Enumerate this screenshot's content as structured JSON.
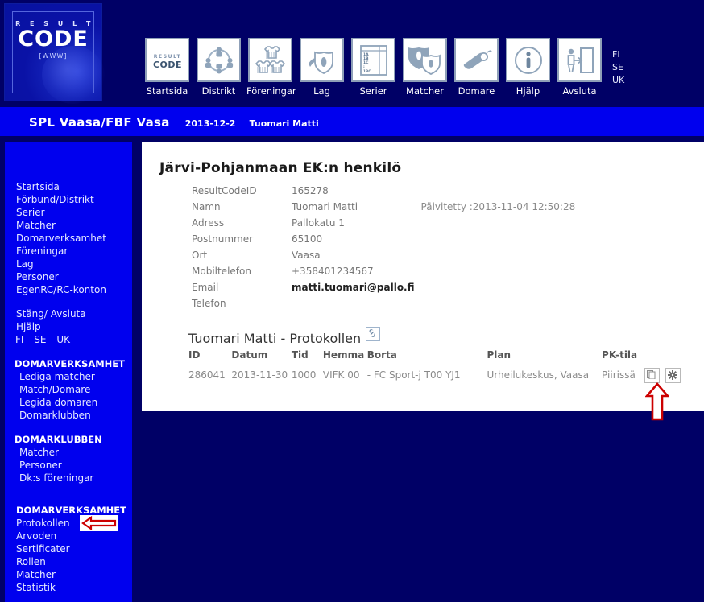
{
  "brand": {
    "logo_result": "R E S U L T",
    "logo_code": "CODE",
    "logo_www": "[WWW]"
  },
  "topnav": {
    "items": [
      {
        "label": "Startsida",
        "icon": "resultcode-logo-icon"
      },
      {
        "label": "Distrikt",
        "icon": "district-network-icon"
      },
      {
        "label": "Föreningar",
        "icon": "clubs-jerseys-icon"
      },
      {
        "label": "Lag",
        "icon": "team-flag-shield-icon"
      },
      {
        "label": "Serier",
        "icon": "series-table-icon"
      },
      {
        "label": "Matcher",
        "icon": "match-shields-icon"
      },
      {
        "label": "Domare",
        "icon": "referee-whistle-icon"
      },
      {
        "label": "Hjälp",
        "icon": "info-circle-icon"
      },
      {
        "label": "Avsluta",
        "icon": "exit-door-icon"
      }
    ],
    "languages": [
      "FI",
      "SE",
      "UK"
    ]
  },
  "subheader": {
    "org": "SPL Vaasa/FBF Vasa",
    "date": "2013-12-2",
    "user": "Tuomari Matti"
  },
  "sidebar": {
    "main_links": [
      "Startsida",
      "Förbund/Distrikt",
      "Serier",
      "Matcher",
      "Domarverksamhet",
      "Föreningar",
      "Lag",
      "Personer",
      "EgenRC/RC-konton"
    ],
    "session_links": [
      "Stäng/ Avsluta",
      "Hjälp"
    ],
    "languages": [
      "FI",
      "SE",
      "UK"
    ],
    "groups": [
      {
        "heading": "DOMARVERKSAMHET",
        "items": [
          "Lediga matcher",
          "Match/Domare",
          "Legida domaren",
          "Domarklubben"
        ]
      },
      {
        "heading": "DOMARKLUBBEN",
        "items": [
          "Matcher",
          "Personer",
          "Dk:s föreningar"
        ]
      },
      {
        "heading": "DOMARVERKSAMHET",
        "items": [
          "Protokollen",
          "Arvoden",
          "Sertificater",
          "Rollen",
          "Matcher",
          "Statistik"
        ]
      }
    ]
  },
  "page": {
    "title": "Järvi-Pohjanmaan EK:n henkilö"
  },
  "details": {
    "rows": [
      {
        "label": "ResultCodeID",
        "value": "165278",
        "extra": "",
        "bold": false
      },
      {
        "label": "Namn",
        "value": "Tuomari Matti",
        "extra": "Päivitetty :2013-11-04 12:50:28",
        "bold": false
      },
      {
        "label": "Adress",
        "value": "Pallokatu 1",
        "extra": "",
        "bold": false
      },
      {
        "label": "Postnummer",
        "value": "65100",
        "extra": "",
        "bold": false
      },
      {
        "label": "Ort",
        "value": "Vaasa",
        "extra": "",
        "bold": false
      },
      {
        "label": "Mobiltelefon",
        "value": "+358401234567",
        "extra": "",
        "bold": false
      },
      {
        "label": "Email",
        "value": "matti.tuomari@pallo.fi",
        "extra": "",
        "bold": true
      },
      {
        "label": "Telefon",
        "value": "",
        "extra": "",
        "bold": false
      }
    ]
  },
  "protocols": {
    "title": "Tuomari Matti - Protokollen",
    "link_icon": "chain-link-icon",
    "columns": [
      "ID",
      "Datum",
      "Tid",
      "Hemma",
      "Borta",
      "Plan",
      "PK-tila"
    ],
    "rows": [
      {
        "id": "286041",
        "datum": "2013-11-30",
        "tid": "1000",
        "hemma": "VIFK 00",
        "separator": "-",
        "borta": "FC Sport-j T00 YJ1",
        "plan": "Urheilukeskus, Vaasa",
        "pk_tila": "Piirissä",
        "actions": [
          "copy-pages-icon",
          "gear-settings-icon"
        ]
      }
    ]
  },
  "annotations": {
    "sidebar_arrow": "red-left-arrow-pointing-to-protokollen",
    "table_arrow": "red-up-arrow-pointing-to-gear-icon"
  },
  "colors": {
    "dark_navy": "#000066",
    "bright_blue": "#0000ee",
    "panel_white": "#ffffff",
    "annotation_red": "#cc0000",
    "icon_blue_gray": "#8fa0b8"
  }
}
